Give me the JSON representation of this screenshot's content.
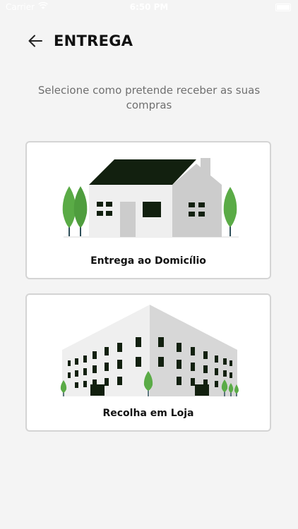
{
  "status_bar": {
    "carrier": "Carrier",
    "time": "6:50 PM"
  },
  "header": {
    "title": "ENTREGA"
  },
  "subtitle": "Selecione como pretende receber as suas compras",
  "options": [
    {
      "label": "Entrega ao Domicílio"
    },
    {
      "label": "Recolha em Loja"
    }
  ],
  "colors": {
    "accent_dark": "#12200f",
    "tree_green": "#5aab46",
    "background": "#f4f4f4",
    "card_border": "#d4d4d4"
  }
}
